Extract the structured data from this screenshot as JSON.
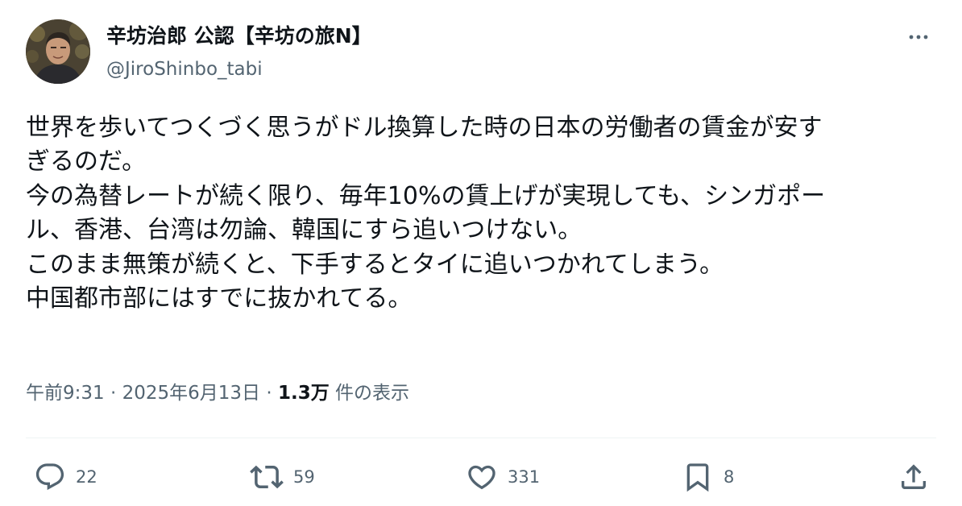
{
  "author": {
    "display_name": "辛坊治郎 公認【辛坊の旅N】",
    "handle": "@JiroShinbo_tabi"
  },
  "post": {
    "lines": [
      "世界を歩いてつくづく思うがドル換算した時の日本の労働者の賃金が安す",
      "ぎるのだ。",
      "今の為替レートが続く限り、毎年10%の賃上げが実現しても、シンガポー",
      "ル、香港、台湾は勿論、韓国にすら追いつけない。",
      "このまま無策が続くと、下手するとタイに追いつかれてしまう。",
      "中国都市部にはすでに抜かれてる。"
    ]
  },
  "meta": {
    "time": "午前9:31",
    "separator": " · ",
    "date": "2025年6月13日",
    "views_count": "1.3万",
    "views_label": " 件の表示"
  },
  "actions": {
    "replies": "22",
    "reposts": "59",
    "likes": "331",
    "bookmarks": "8"
  },
  "icons": {
    "more": "more-horizontal-icon",
    "reply": "reply-icon",
    "repost": "repost-icon",
    "like": "heart-icon",
    "bookmark": "bookmark-icon",
    "share": "share-icon"
  },
  "colors": {
    "text_primary": "#0f1419",
    "text_secondary": "#536471",
    "divider": "#eff3f4"
  }
}
